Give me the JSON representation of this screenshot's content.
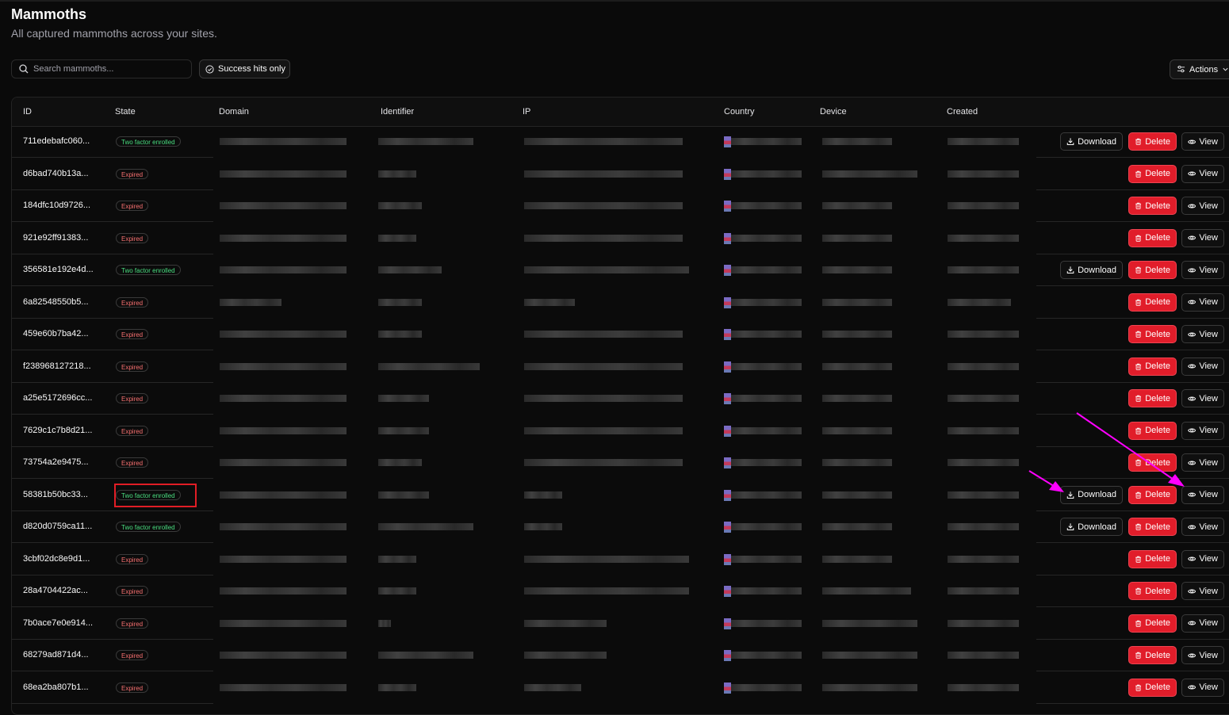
{
  "header": {
    "title": "Mammoths",
    "subtitle": "All captured mammoths across your sites."
  },
  "toolbar": {
    "search_placeholder": "Search mammoths...",
    "filter_label": "Success hits only",
    "actions_label": "Actions"
  },
  "table": {
    "columns": [
      "ID",
      "State",
      "Domain",
      "Identifier",
      "IP",
      "Country",
      "Device",
      "Created"
    ],
    "action_labels": {
      "download": "Download",
      "delete": "Delete",
      "view": "View"
    },
    "rows": [
      {
        "id": "711edebafc060...",
        "state": "Two factor enrolled",
        "ok": true
      },
      {
        "id": "d6bad740b13a...",
        "state": "Expired",
        "ok": false
      },
      {
        "id": "184dfc10d9726...",
        "state": "Expired",
        "ok": false
      },
      {
        "id": "921e92ff91383...",
        "state": "Expired",
        "ok": false
      },
      {
        "id": "356581e192e4d...",
        "state": "Two factor enrolled",
        "ok": true
      },
      {
        "id": "6a82548550b5...",
        "state": "Expired",
        "ok": false
      },
      {
        "id": "459e60b7ba42...",
        "state": "Expired",
        "ok": false
      },
      {
        "id": "f238968127218...",
        "state": "Expired",
        "ok": false
      },
      {
        "id": "a25e5172696cc...",
        "state": "Expired",
        "ok": false
      },
      {
        "id": "7629c1c7b8d21...",
        "state": "Expired",
        "ok": false
      },
      {
        "id": "73754a2e9475...",
        "state": "Expired",
        "ok": false
      },
      {
        "id": "58381b50bc33...",
        "state": "Two factor enrolled",
        "ok": true
      },
      {
        "id": "d820d0759ca11...",
        "state": "Two factor enrolled",
        "ok": true
      },
      {
        "id": "3cbf02dc8e9d1...",
        "state": "Expired",
        "ok": false
      },
      {
        "id": "28a4704422ac...",
        "state": "Expired",
        "ok": false
      },
      {
        "id": "7b0ace7e0e914...",
        "state": "Expired",
        "ok": false
      },
      {
        "id": "68279ad871d4...",
        "state": "Expired",
        "ok": false
      },
      {
        "id": "68ea2ba807b1...",
        "state": "Expired",
        "ok": false
      }
    ]
  },
  "colors": {
    "background": "#0a0a0a",
    "delete": "#e11d2a",
    "success_badge": "#4ade80",
    "expired_badge": "#f87171",
    "annotation_arrow": "#ff00ff",
    "annotation_box": "#e11d25"
  }
}
